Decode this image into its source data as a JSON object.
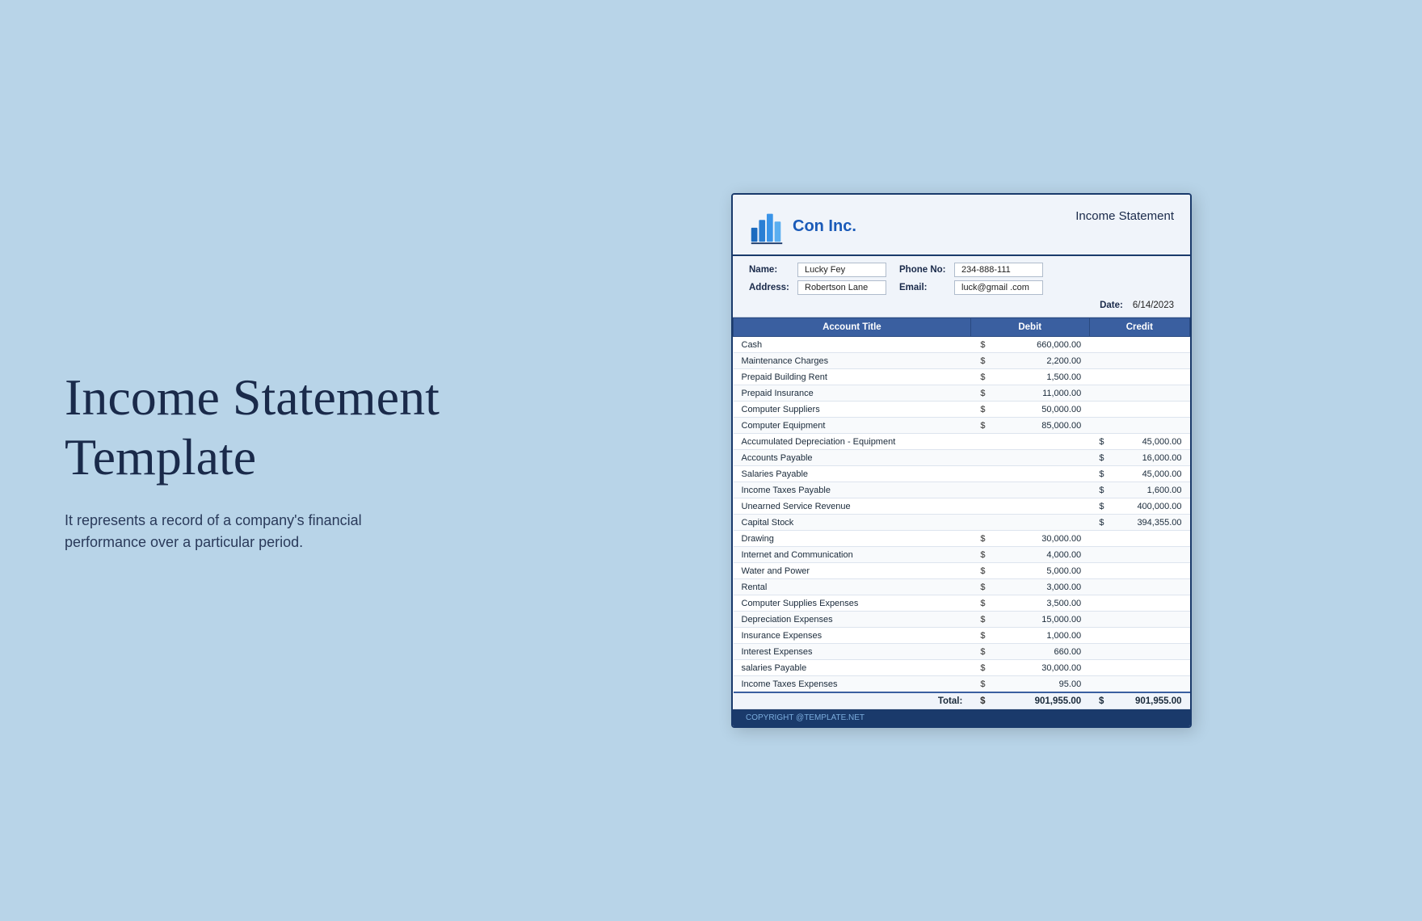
{
  "left": {
    "title": "Income Statement Template",
    "description": "It represents a record of a company's financial performance over a particular period."
  },
  "doc": {
    "header_title": "Income Statement",
    "company_name": "Con Inc.",
    "fields": {
      "name_label": "Name:",
      "name_value": "Lucky Fey",
      "phone_label": "Phone No:",
      "phone_value": "234-888-111",
      "address_label": "Address:",
      "address_value": "Robertson Lane",
      "email_label": "Email:",
      "email_value": "luck@gmail .com",
      "date_label": "Date:",
      "date_value": "6/14/2023"
    },
    "table_headers": {
      "account": "Account Title",
      "debit": "Debit",
      "credit": "Credit"
    },
    "rows": [
      {
        "account": "Cash",
        "debit_dollar": "$",
        "debit": "660,000.00",
        "credit_dollar": "",
        "credit": ""
      },
      {
        "account": "Maintenance Charges",
        "debit_dollar": "$",
        "debit": "2,200.00",
        "credit_dollar": "",
        "credit": ""
      },
      {
        "account": "Prepaid Building Rent",
        "debit_dollar": "$",
        "debit": "1,500.00",
        "credit_dollar": "",
        "credit": ""
      },
      {
        "account": "Prepaid Insurance",
        "debit_dollar": "$",
        "debit": "11,000.00",
        "credit_dollar": "",
        "credit": ""
      },
      {
        "account": "Computer Suppliers",
        "debit_dollar": "$",
        "debit": "50,000.00",
        "credit_dollar": "",
        "credit": ""
      },
      {
        "account": "Computer Equipment",
        "debit_dollar": "$",
        "debit": "85,000.00",
        "credit_dollar": "",
        "credit": ""
      },
      {
        "account": "Accumulated Depreciation - Equipment",
        "debit_dollar": "",
        "debit": "",
        "credit_dollar": "$",
        "credit": "45,000.00"
      },
      {
        "account": "Accounts Payable",
        "debit_dollar": "",
        "debit": "",
        "credit_dollar": "$",
        "credit": "16,000.00"
      },
      {
        "account": "Salaries Payable",
        "debit_dollar": "",
        "debit": "",
        "credit_dollar": "$",
        "credit": "45,000.00"
      },
      {
        "account": "Income Taxes Payable",
        "debit_dollar": "",
        "debit": "",
        "credit_dollar": "$",
        "credit": "1,600.00"
      },
      {
        "account": "Unearned Service Revenue",
        "debit_dollar": "",
        "debit": "",
        "credit_dollar": "$",
        "credit": "400,000.00"
      },
      {
        "account": "Capital Stock",
        "debit_dollar": "",
        "debit": "",
        "credit_dollar": "$",
        "credit": "394,355.00"
      },
      {
        "account": "Drawing",
        "debit_dollar": "$",
        "debit": "30,000.00",
        "credit_dollar": "",
        "credit": ""
      },
      {
        "account": "Internet and Communication",
        "debit_dollar": "$",
        "debit": "4,000.00",
        "credit_dollar": "",
        "credit": ""
      },
      {
        "account": "Water and Power",
        "debit_dollar": "$",
        "debit": "5,000.00",
        "credit_dollar": "",
        "credit": ""
      },
      {
        "account": "Rental",
        "debit_dollar": "$",
        "debit": "3,000.00",
        "credit_dollar": "",
        "credit": ""
      },
      {
        "account": "Computer Supplies Expenses",
        "debit_dollar": "$",
        "debit": "3,500.00",
        "credit_dollar": "",
        "credit": ""
      },
      {
        "account": "Depreciation Expenses",
        "debit_dollar": "$",
        "debit": "15,000.00",
        "credit_dollar": "",
        "credit": ""
      },
      {
        "account": "Insurance Expenses",
        "debit_dollar": "$",
        "debit": "1,000.00",
        "credit_dollar": "",
        "credit": ""
      },
      {
        "account": "Interest Expenses",
        "debit_dollar": "$",
        "debit": "660.00",
        "credit_dollar": "",
        "credit": ""
      },
      {
        "account": "salaries Payable",
        "debit_dollar": "$",
        "debit": "30,000.00",
        "credit_dollar": "",
        "credit": ""
      },
      {
        "account": "Income Taxes Expenses",
        "debit_dollar": "$",
        "debit": "95.00",
        "credit_dollar": "",
        "credit": ""
      }
    ],
    "total": {
      "label": "Total:",
      "debit_dollar": "$",
      "debit": "901,955.00",
      "credit_dollar": "$",
      "credit": "901,955.00"
    },
    "footer": "COPYRIGHT @TEMPLATE.NET"
  }
}
